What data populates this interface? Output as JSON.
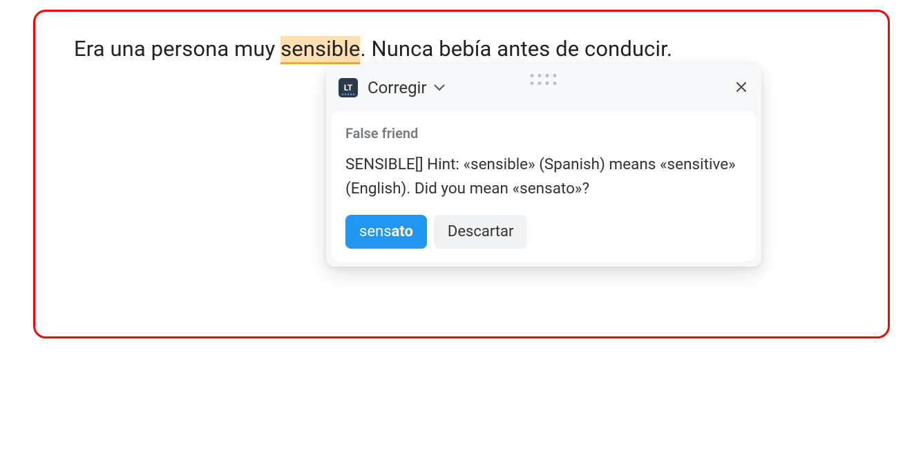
{
  "editor": {
    "text_before": "Era una persona muy ",
    "highlighted_word": "sensible",
    "text_after": ". Nunca bebía antes de conducir."
  },
  "popup": {
    "logo_text": "LT",
    "correct_label": "Corregir",
    "category": "False friend",
    "explanation": "SENSIBLE[] Hint: «sensible» (Spanish) means «sensitive» (English). Did you mean «sensato»?",
    "suggestion_prefix": "sens",
    "suggestion_suffix": "ato",
    "dismiss_label": "Descartar"
  }
}
